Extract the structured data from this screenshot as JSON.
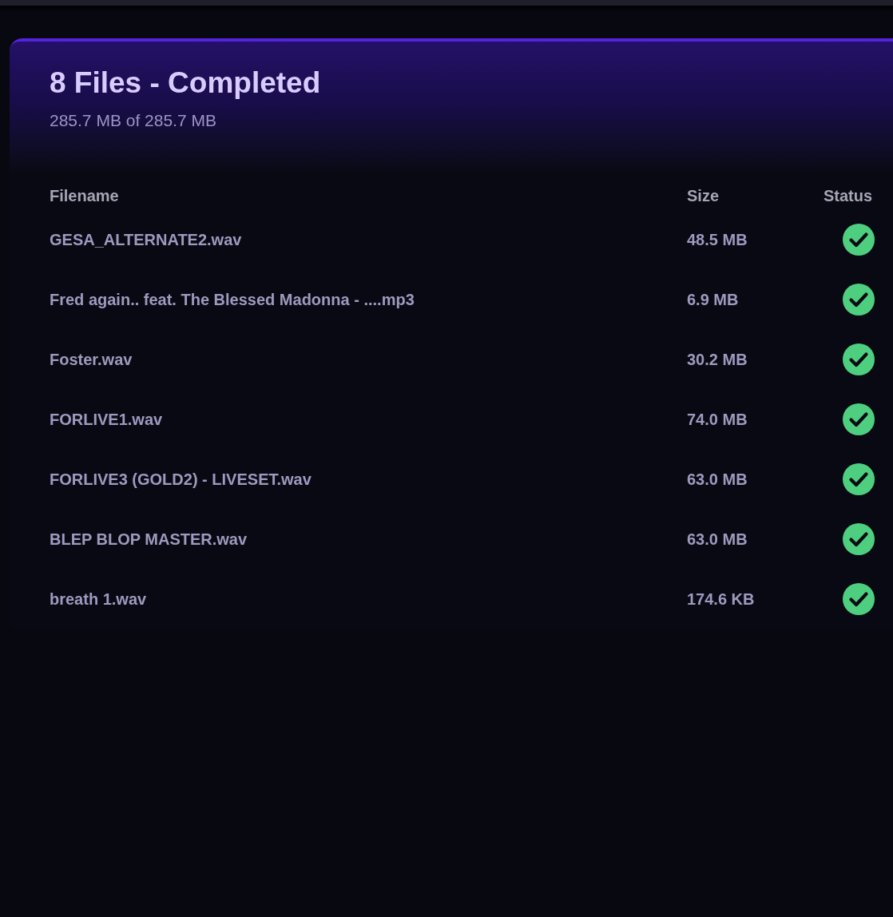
{
  "header": {
    "title": "8 Files - Completed",
    "subtitle": "285.7 MB of 285.7 MB"
  },
  "table": {
    "columns": [
      "Filename",
      "Size",
      "Status"
    ],
    "rows": [
      {
        "filename": "GESA_ALTERNATE2.wav",
        "size": "48.5 MB",
        "completed": true
      },
      {
        "filename": "Fred again.. feat. The Blessed Madonna - ....mp3",
        "size": "6.9 MB",
        "completed": true
      },
      {
        "filename": "Foster.wav",
        "size": "30.2 MB",
        "completed": true
      },
      {
        "filename": "FORLIVE1.wav",
        "size": "74.0 MB",
        "completed": true
      },
      {
        "filename": "FORLIVE3 (GOLD2) - LIVESET.wav",
        "size": "63.0 MB",
        "completed": true
      },
      {
        "filename": "BLEP BLOP MASTER.wav",
        "size": "63.0 MB",
        "completed": true
      },
      {
        "filename": "breath 1.wav",
        "size": "174.6 KB",
        "completed": true
      }
    ]
  }
}
